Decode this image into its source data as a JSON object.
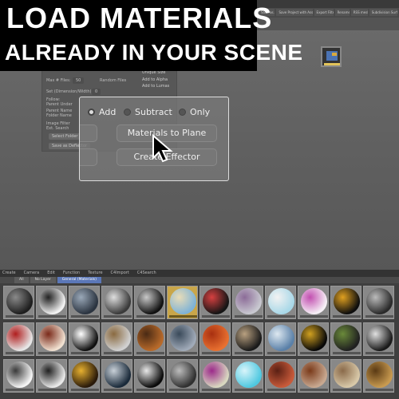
{
  "banner": {
    "line1": "LOAD MATERIALS",
    "line2": "ALREADY IN YOUR SCENE"
  },
  "toolbar": {
    "buttons": [
      "Save as...",
      "Save Project with Assets...",
      "Export Filter",
      "Rename",
      "RSS mesh",
      "Subdivision Surface"
    ]
  },
  "settings_panel": {
    "max_files_label": "Max # Files:",
    "max_files_value": "50",
    "random_files_label": "Random Files",
    "set_dimension_label": "Set (Dimension/Width)",
    "set_dimension_value": "0",
    "follow_label": "Follow:",
    "follow_value": "Parent Under",
    "parent_name_label": "Parent Name",
    "folder_name_label": "Folder Name",
    "image_filter_label": "Image Filter",
    "image_filter_value": "Ext. Search",
    "select_folder_label": "Select Folder",
    "save_deflector_label": "Save as Deflector",
    "add_to_alpha_label": "Add to Alpha",
    "add_to_lumas_label": "Add to Lumas",
    "unique_size_label": "Unique Size"
  },
  "popup": {
    "mode_options": [
      {
        "label": "Add",
        "selected": true
      },
      {
        "label": "Subtract",
        "selected": false
      },
      {
        "label": "Only",
        "selected": false
      }
    ],
    "materials_to_plane_label": "Materials to Plane",
    "create_effector_label": "Create Effector"
  },
  "material_manager": {
    "menu": [
      "Create",
      "Camera",
      "Edit",
      "Function",
      "Texture",
      "C4Import",
      "C4Search"
    ],
    "tabs": [
      {
        "label": "All",
        "selected": false
      },
      {
        "label": "No Layer",
        "selected": false
      },
      {
        "label": "General (Materials)",
        "selected": true
      }
    ],
    "selected_material_index": 5,
    "materials": [
      {
        "colors": [
          "#1e1e1e",
          "#8a8a8a"
        ]
      },
      {
        "colors": [
          "#f2f2f2",
          "#222222"
        ]
      },
      {
        "colors": [
          "#2b3440",
          "#9aa8b8"
        ]
      },
      {
        "colors": [
          "#3a3a3a",
          "#dedede"
        ]
      },
      {
        "colors": [
          "#111111",
          "#c8c8c8"
        ]
      },
      {
        "colors": [
          "#7fb3d6",
          "#e8dcb8"
        ]
      },
      {
        "colors": [
          "#151515",
          "#d64040"
        ]
      },
      {
        "colors": [
          "#c8c8d0",
          "#8c6c98"
        ]
      },
      {
        "colors": [
          "#a8d8e8",
          "#f2f2f2"
        ]
      },
      {
        "colors": [
          "#f6f0f6",
          "#c24fb0"
        ]
      },
      {
        "colors": [
          "#0e0e0e",
          "#e0a020"
        ]
      },
      {
        "colors": [
          "#2a2a2a",
          "#bbbbbb"
        ]
      },
      {
        "colors": [
          "#e6e6e6",
          "#b01e1e"
        ]
      },
      {
        "colors": [
          "#f0e0d0",
          "#7a2a1a"
        ]
      },
      {
        "colors": [
          "#101010",
          "#ffffff"
        ]
      },
      {
        "colors": [
          "#d0d0d0",
          "#8a6a40"
        ]
      },
      {
        "colors": [
          "#b86a2a",
          "#4a2a14"
        ]
      },
      {
        "colors": [
          "#a0aab8",
          "#3a4a5a"
        ]
      },
      {
        "colors": [
          "#e87030",
          "#a83010"
        ]
      },
      {
        "colors": [
          "#1a1a1a",
          "#b8a080"
        ]
      },
      {
        "colors": [
          "#5a80a8",
          "#dde8f0"
        ]
      },
      {
        "colors": [
          "#080808",
          "#d0a020"
        ]
      },
      {
        "colors": [
          "#202020",
          "#6a8a3a"
        ]
      },
      {
        "colors": [
          "#1a1a1a",
          "#e0e0e0"
        ]
      },
      {
        "colors": [
          "#f4f4f4",
          "#3a3a3a"
        ]
      },
      {
        "colors": [
          "#e8e8e8",
          "#202020"
        ]
      },
      {
        "colors": [
          "#2a1a0a",
          "#e6b030"
        ]
      },
      {
        "colors": [
          "#1a2a3a",
          "#c8d0d8"
        ]
      },
      {
        "colors": [
          "#0a0a0a",
          "#e8e8e8"
        ]
      },
      {
        "colors": [
          "#303030",
          "#bcbcbc"
        ]
      },
      {
        "colors": [
          "#d8d8c0",
          "#9c2a8a"
        ]
      },
      {
        "colors": [
          "#4fc8e0",
          "#d8f4fa"
        ]
      },
      {
        "colors": [
          "#c85a3a",
          "#5a2014"
        ]
      },
      {
        "colors": [
          "#c8a890",
          "#7a3a1a"
        ]
      },
      {
        "colors": [
          "#d8c8a8",
          "#8a6a4a"
        ]
      },
      {
        "colors": [
          "#c89a50",
          "#5a3a14"
        ]
      }
    ]
  }
}
